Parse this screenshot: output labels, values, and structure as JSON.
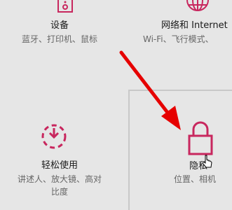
{
  "tiles": {
    "devices": {
      "title": "设备",
      "description": "蓝牙、打印机、鼠标",
      "icon": "devices-icon"
    },
    "network": {
      "title": "网络和 Internet",
      "description": "Wi-Fi、飞行模式、",
      "icon": "globe-icon"
    },
    "ease_of_access": {
      "title": "轻松使用",
      "description": "讲述人、放大镜、高对比度",
      "icon": "ease-of-access-icon"
    },
    "privacy": {
      "title": "隐私",
      "description": "位置、相机",
      "icon": "lock-icon"
    }
  },
  "colors": {
    "accent": "#c8275e",
    "annotation_arrow": "#e60000",
    "background": "#e6e6e6",
    "hover_border": "#c8c8c8"
  }
}
